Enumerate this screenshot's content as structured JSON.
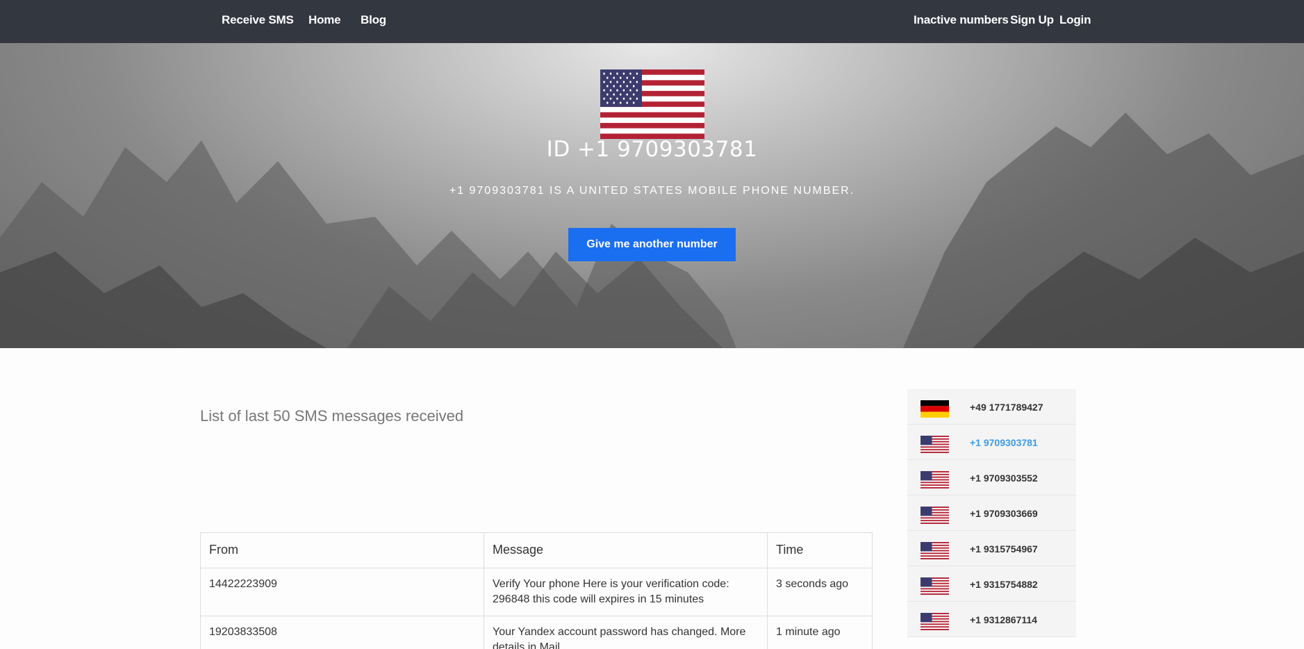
{
  "nav": {
    "brand": "Receive SMS",
    "home": "Home",
    "blog": "Blog",
    "inactive": "Inactive numbers",
    "signup": "Sign Up",
    "login": "Login"
  },
  "hero": {
    "flag": "us-flag",
    "id_text": "ID +1 9709303781",
    "description": "+1 9709303781 IS A UNITED STATES MOBILE PHONE NUMBER.",
    "button": "Give me another number"
  },
  "main": {
    "list_title": "List of last 50 SMS messages received",
    "columns": [
      "From",
      "Message",
      "Time"
    ],
    "rows": [
      {
        "from": "14422223909",
        "message": "Verify Your phone Here is your verification code: 296848 this code will expires in 15 minutes",
        "time": "3 seconds ago"
      },
      {
        "from": "19203833508",
        "message": "Your Yandex account password has changed. More details in Mail",
        "time": "1 minute ago"
      }
    ]
  },
  "sidebar": {
    "items": [
      {
        "flag": "de-flag",
        "number": "+49 1771789427",
        "active": false
      },
      {
        "flag": "us-flag",
        "number": "+1 9709303781",
        "active": true
      },
      {
        "flag": "us-flag",
        "number": "+1 9709303552",
        "active": false
      },
      {
        "flag": "us-flag",
        "number": "+1 9709303669",
        "active": false
      },
      {
        "flag": "us-flag",
        "number": "+1 9315754967",
        "active": false
      },
      {
        "flag": "us-flag",
        "number": "+1 9315754882",
        "active": false
      },
      {
        "flag": "us-flag",
        "number": "+1 9312867114",
        "active": false
      }
    ]
  },
  "colors": {
    "nav_bg": "#333740",
    "button_bg": "#1a6ef0",
    "active_link": "#3d9be9"
  }
}
